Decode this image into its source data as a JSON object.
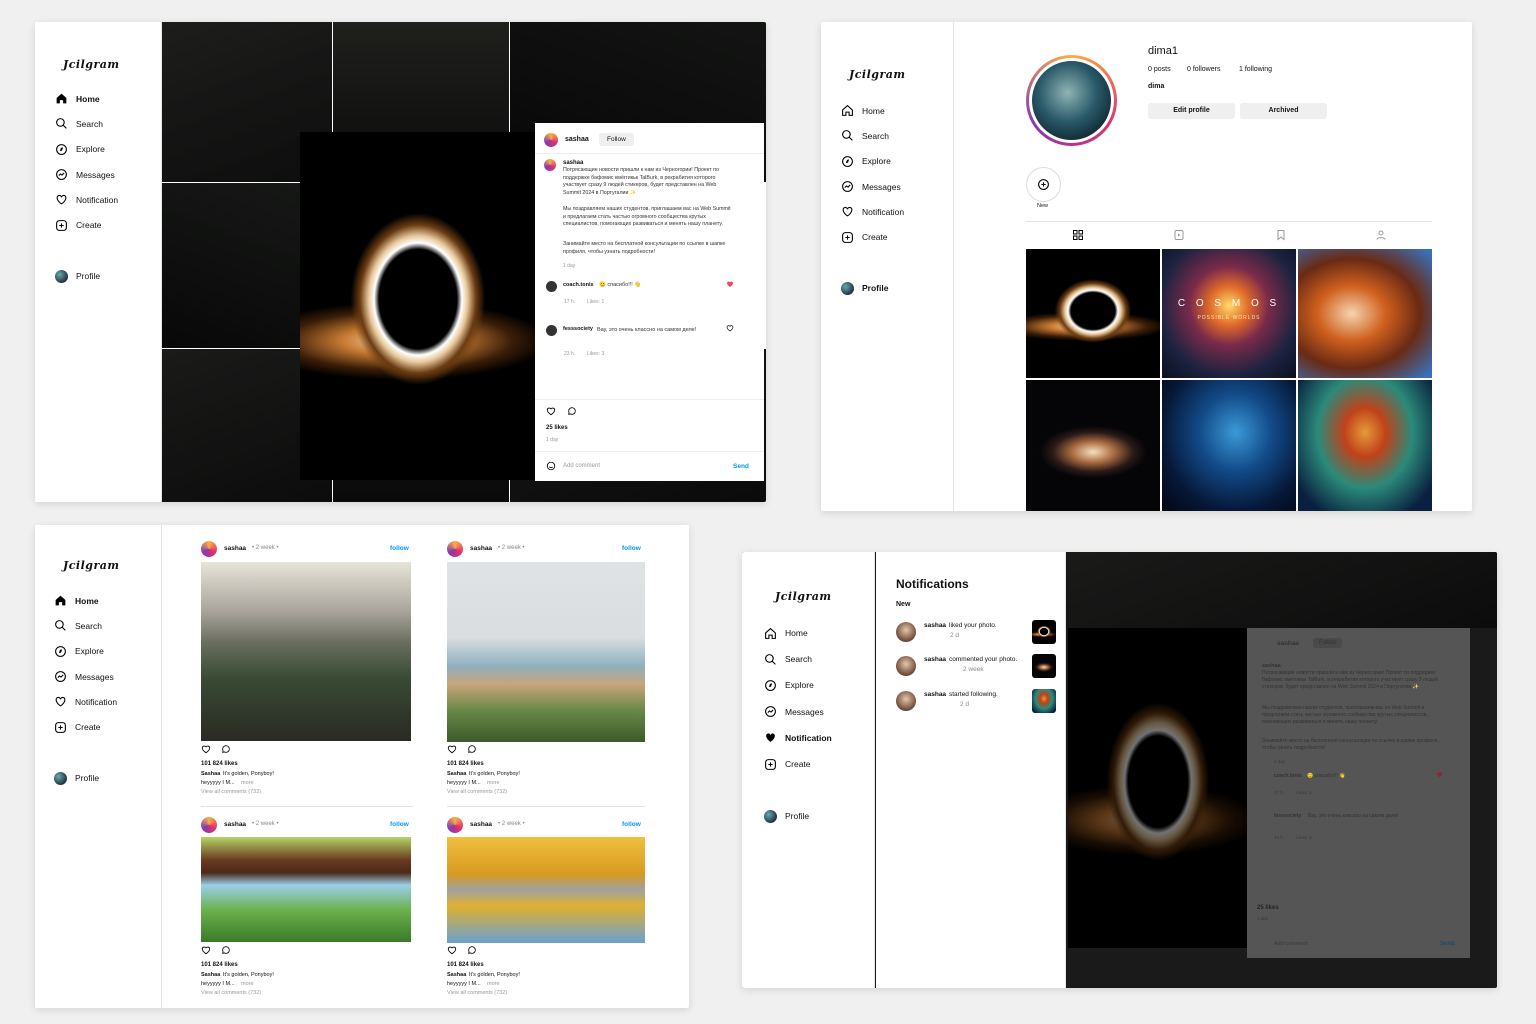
{
  "app": {
    "logo": "Jcilgram"
  },
  "nav": {
    "home": "Home",
    "search": "Search",
    "explore": "Explore",
    "messages": "Messages",
    "notification": "Notification",
    "create": "Create",
    "profile": "Profile"
  },
  "post_modal": {
    "author": "sashaa",
    "follow": "Follow",
    "caption_author": "sashaa",
    "caption_p1": "Потрясающие новости пришли к нам из Черногории! Проект по поддержке бафомис кмёггикьк TalBurk, в рекрабития которого участвует сразу 9 людей стикеров, будет представлен на Web Summit 2024 в Португалии ✨",
    "caption_p2": "Мы поздравляем наших студентов, приглашаем вас на Web Summit и предлагаем стать частью огромного сообщества крутых специалистов, помогающих развиваться и менять нашу планету.",
    "caption_p3": "Занимайте место на бесплатной консультации по ссылке в шапке профиля, чтобы узнать подробности!",
    "caption_time": "1 day",
    "comments": [
      {
        "user": "coach.tonis",
        "text": "😊 спасибо!!! 👋",
        "time": "17 h.",
        "likes": "Likes: 1"
      },
      {
        "user": "fesssociety",
        "text": "Вау, это очень классно на самом деле!",
        "time": "23 h.",
        "likes": "Likes: 3"
      }
    ],
    "likes": "25 likes",
    "time": "1 day",
    "add_comment_placeholder": "Add comment",
    "send": "Send"
  },
  "profile": {
    "username": "dima1",
    "posts": "0 posts",
    "followers": "0 followers",
    "following": "1 following",
    "name": "dima",
    "edit_profile": "Edit profile",
    "archived": "Archived",
    "highlight_new": "New",
    "grid_label_cosmos": "C O S M O S",
    "grid_sub_cosmos": "POSSIBLE WORLDS"
  },
  "feed": {
    "posts": [
      {
        "user": "sashaa",
        "age": "• 2 week •",
        "follow": "follow",
        "likes": "101 824 likes",
        "caption_user": "Sashaa",
        "caption": "It's golden, Ponyboy!",
        "caption2": "heyyyyy I M...",
        "more": "more",
        "view_all": "View all comments (732)"
      },
      {
        "user": "sashaa",
        "age": "• 2 week •",
        "follow": "follow",
        "likes": "101 824 likes",
        "caption_user": "Sashaa",
        "caption": "It's golden, Ponyboy!",
        "caption2": "heyyyyy I M...",
        "more": "more",
        "view_all": "View all comments (732)"
      },
      {
        "user": "sashaa",
        "age": "• 2 week •",
        "follow": "follow",
        "likes": "101 824 likes",
        "caption_user": "Sashaa",
        "caption": "It's golden, Ponyboy!",
        "caption2": "heyyyyy I M...",
        "more": "more",
        "view_all": "View all comments (732)"
      },
      {
        "user": "sashaa",
        "age": "• 2 week •",
        "follow": "follow",
        "likes": "101 824 likes",
        "caption_user": "Sashaa",
        "caption": "It's golden, Ponyboy!",
        "caption2": "heyyyyy I M...",
        "more": "more",
        "view_all": "View all comments (732)"
      }
    ]
  },
  "notifications": {
    "title": "Notifications",
    "section": "New",
    "items": [
      {
        "user": "sashaa",
        "text": "liked your photo.",
        "time": "2 d"
      },
      {
        "user": "sashaa",
        "text": "commented your photo.",
        "time": "2 week"
      },
      {
        "user": "sashaa",
        "text": "started following.",
        "time": "2 d"
      }
    ]
  },
  "colors": {
    "accent": "#0095f6",
    "like": "#ed4956"
  }
}
